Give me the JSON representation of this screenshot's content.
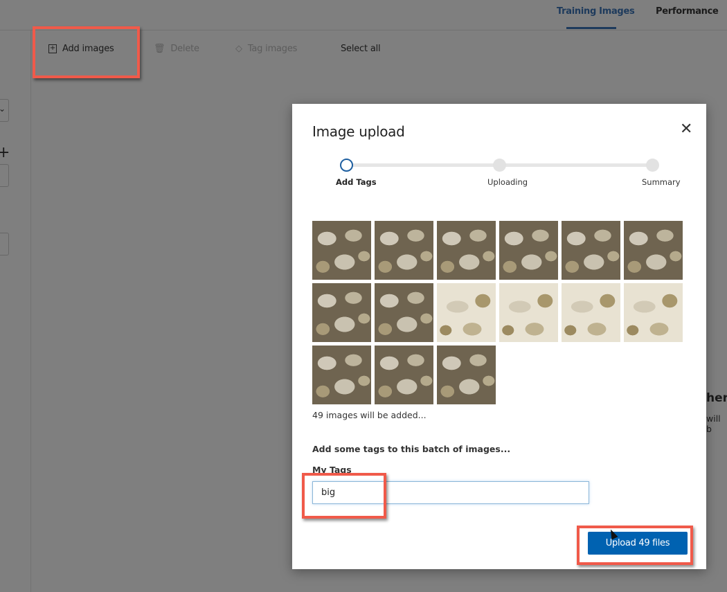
{
  "tabs": [
    {
      "label": "Training Images",
      "active": true
    },
    {
      "label": "Performance",
      "active": false
    }
  ],
  "toolbar": {
    "add_images": "Add images",
    "delete": "Delete",
    "tag_images": "Tag images",
    "select_all": "Select all"
  },
  "background": {
    "heading_fragment": "here",
    "sub_fragment": "will b"
  },
  "modal": {
    "title": "Image upload",
    "steps": [
      {
        "label": "Add Tags",
        "current": true
      },
      {
        "label": "Uploading",
        "current": false
      },
      {
        "label": "Summary",
        "current": false
      }
    ],
    "thumbnails_shown": 15,
    "count_text": "49 images will be added...",
    "prompt": "Add some tags to this batch of images...",
    "tags_label": "My Tags",
    "tags_value": "big",
    "upload_button": "Upload 49 files"
  },
  "colors": {
    "accent": "#0062b1",
    "highlight": "#f05a4a",
    "tab_active": "#1d3a5c"
  }
}
